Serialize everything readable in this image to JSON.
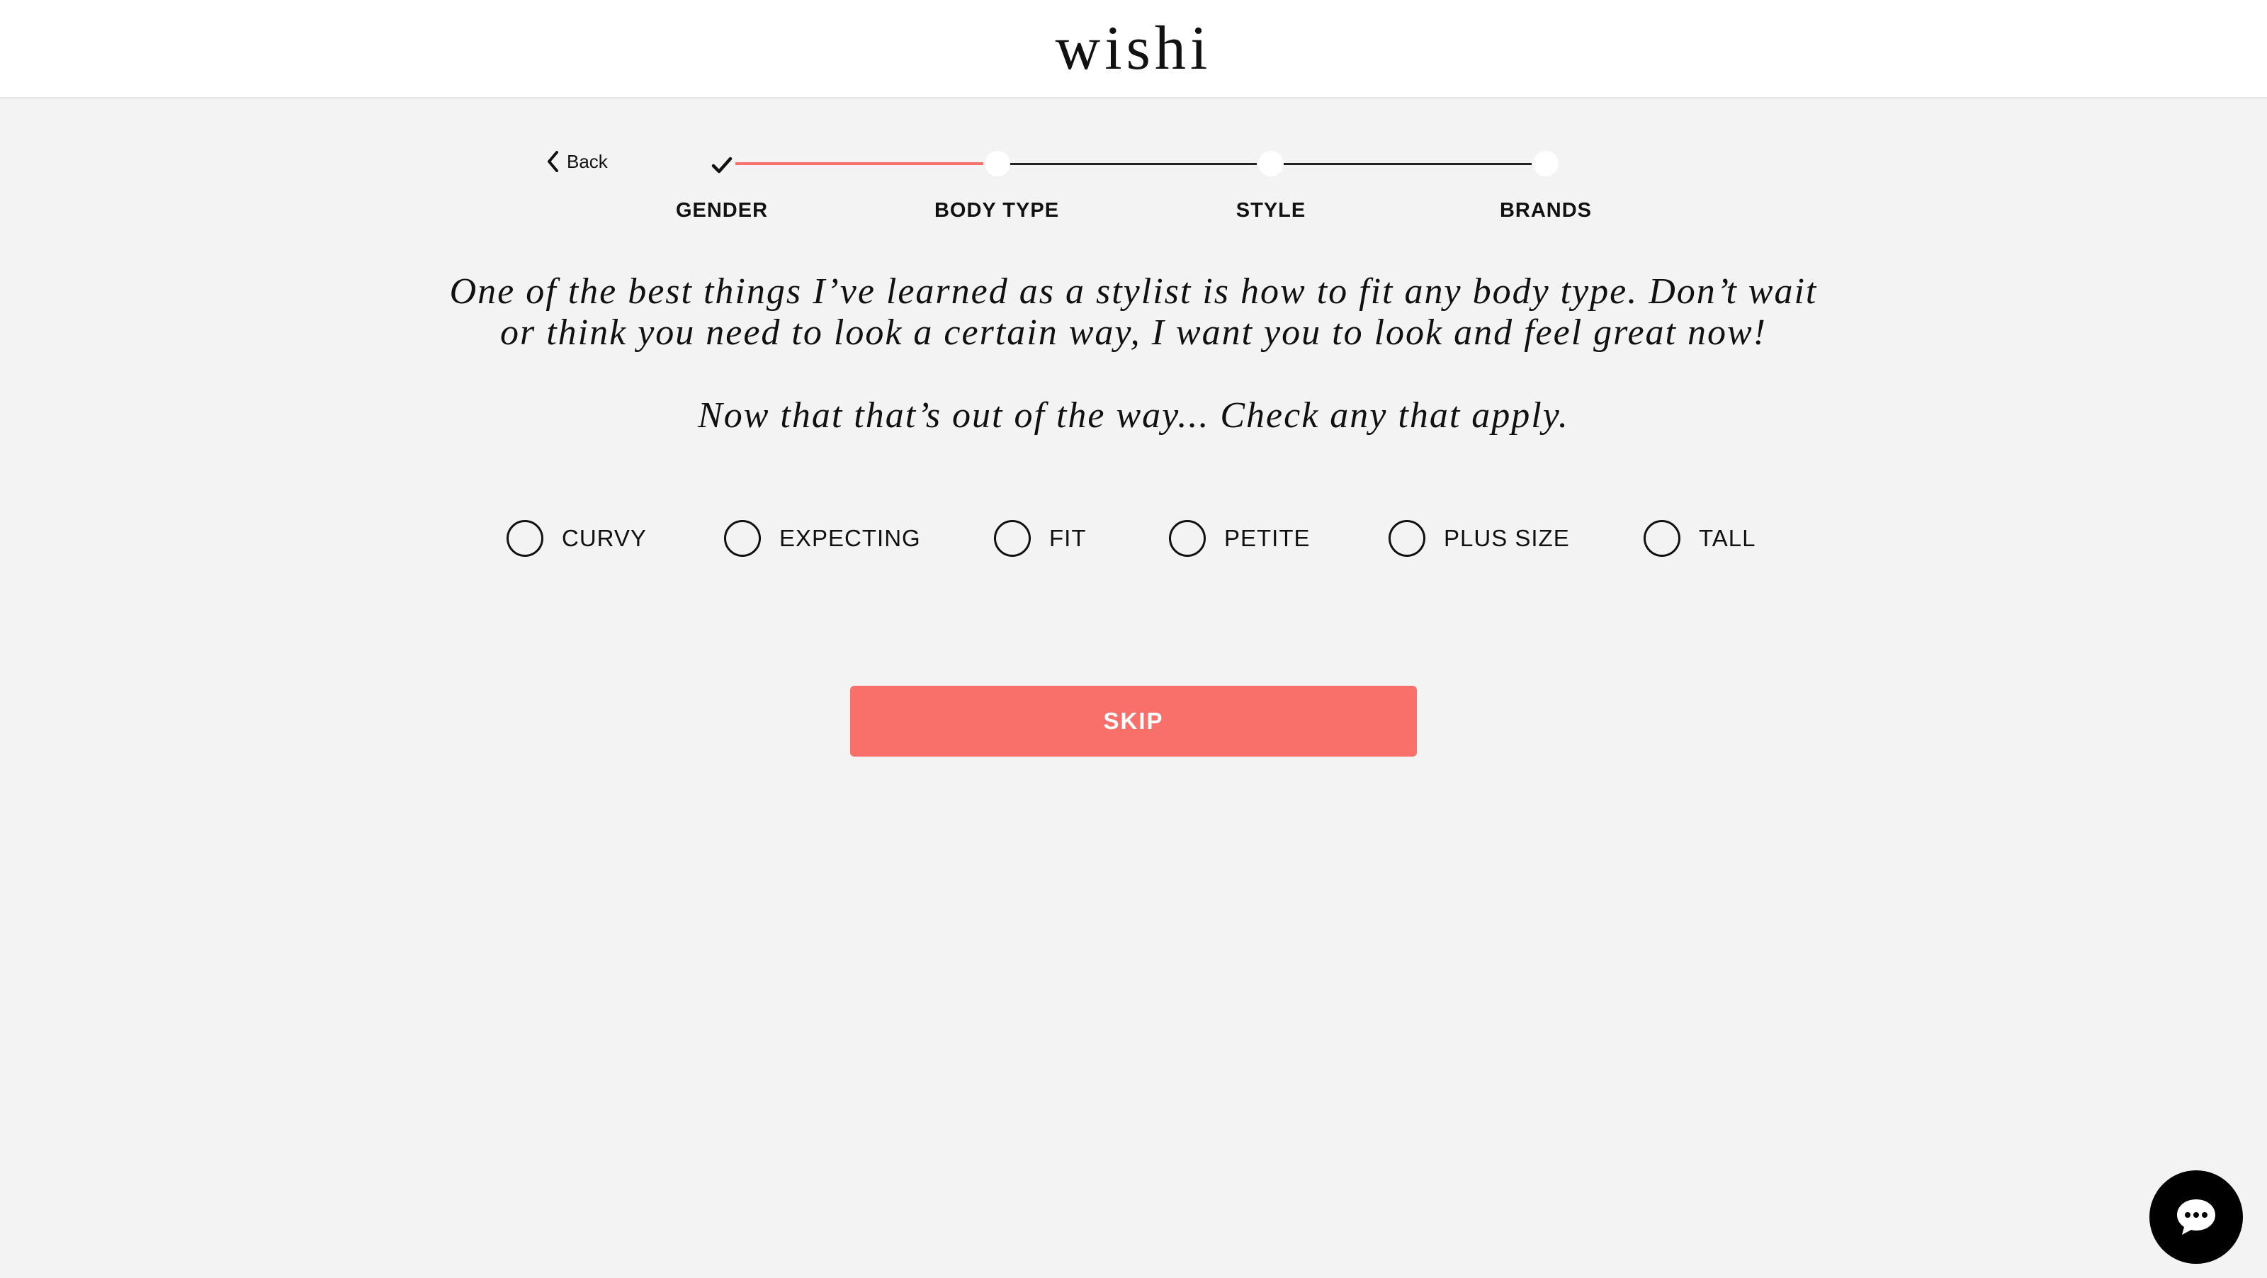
{
  "header": {
    "logo": "wishi"
  },
  "nav": {
    "back_label": "Back"
  },
  "stepper": {
    "steps": [
      {
        "label": "GENDER",
        "state": "done"
      },
      {
        "label": "BODY TYPE",
        "state": "current"
      },
      {
        "label": "STYLE",
        "state": "todo"
      },
      {
        "label": "BRANDS",
        "state": "todo"
      }
    ]
  },
  "intro": {
    "line1": "One of the best things I’ve learned as a stylist is how to fit any body type. Don’t wait",
    "line2": "or think you need to look a certain way, I want you to look and feel great now!",
    "prompt": "Now that that’s out of the way... Check any that apply."
  },
  "options": [
    {
      "label": "CURVY",
      "checked": false
    },
    {
      "label": "EXPECTING",
      "checked": false
    },
    {
      "label": "FIT",
      "checked": false
    },
    {
      "label": "PETITE",
      "checked": false
    },
    {
      "label": "PLUS SIZE",
      "checked": false
    },
    {
      "label": "TALL",
      "checked": false
    }
  ],
  "actions": {
    "skip_label": "SKIP"
  },
  "icons": {
    "back": "chevron-left-icon",
    "check": "check-icon",
    "chat": "chat-bubble-icon"
  },
  "colors": {
    "accent": "#f87069",
    "background": "#f3f3f3",
    "header": "#ffffff",
    "text": "#111111"
  }
}
